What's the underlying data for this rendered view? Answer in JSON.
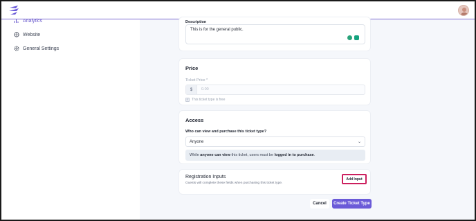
{
  "sidebar": {
    "items": [
      {
        "label": "Analytics",
        "icon": "chart-icon",
        "active": true
      },
      {
        "label": "Website",
        "icon": "globe-icon"
      },
      {
        "label": "General Settings",
        "icon": "gear-icon"
      }
    ]
  },
  "description": {
    "label": "Description",
    "value": "This is for the general public."
  },
  "price": {
    "title": "Price",
    "field_label": "Ticket Price *",
    "currency": "$",
    "placeholder": "0.00",
    "free_label": "This ticket type is free",
    "free_checked": true
  },
  "access": {
    "title": "Access",
    "question": "Who can view and purchase this ticket type?",
    "selected": "Anyone",
    "notice_prefix": "While ",
    "notice_bold1": "anyone can view",
    "notice_mid": " this ticket, users must be ",
    "notice_bold2": "logged in to purchase",
    "notice_end": "."
  },
  "registration": {
    "title": "Registration Inputs",
    "subtitle": "Guests will complete these fields when purchasing this ticket type.",
    "add_label": "Add Input"
  },
  "actions": {
    "cancel": "Cancel",
    "create": "Create Ticket Type"
  },
  "colors": {
    "accent": "#6b5bd8",
    "highlight_border": "#cc1f5e"
  }
}
